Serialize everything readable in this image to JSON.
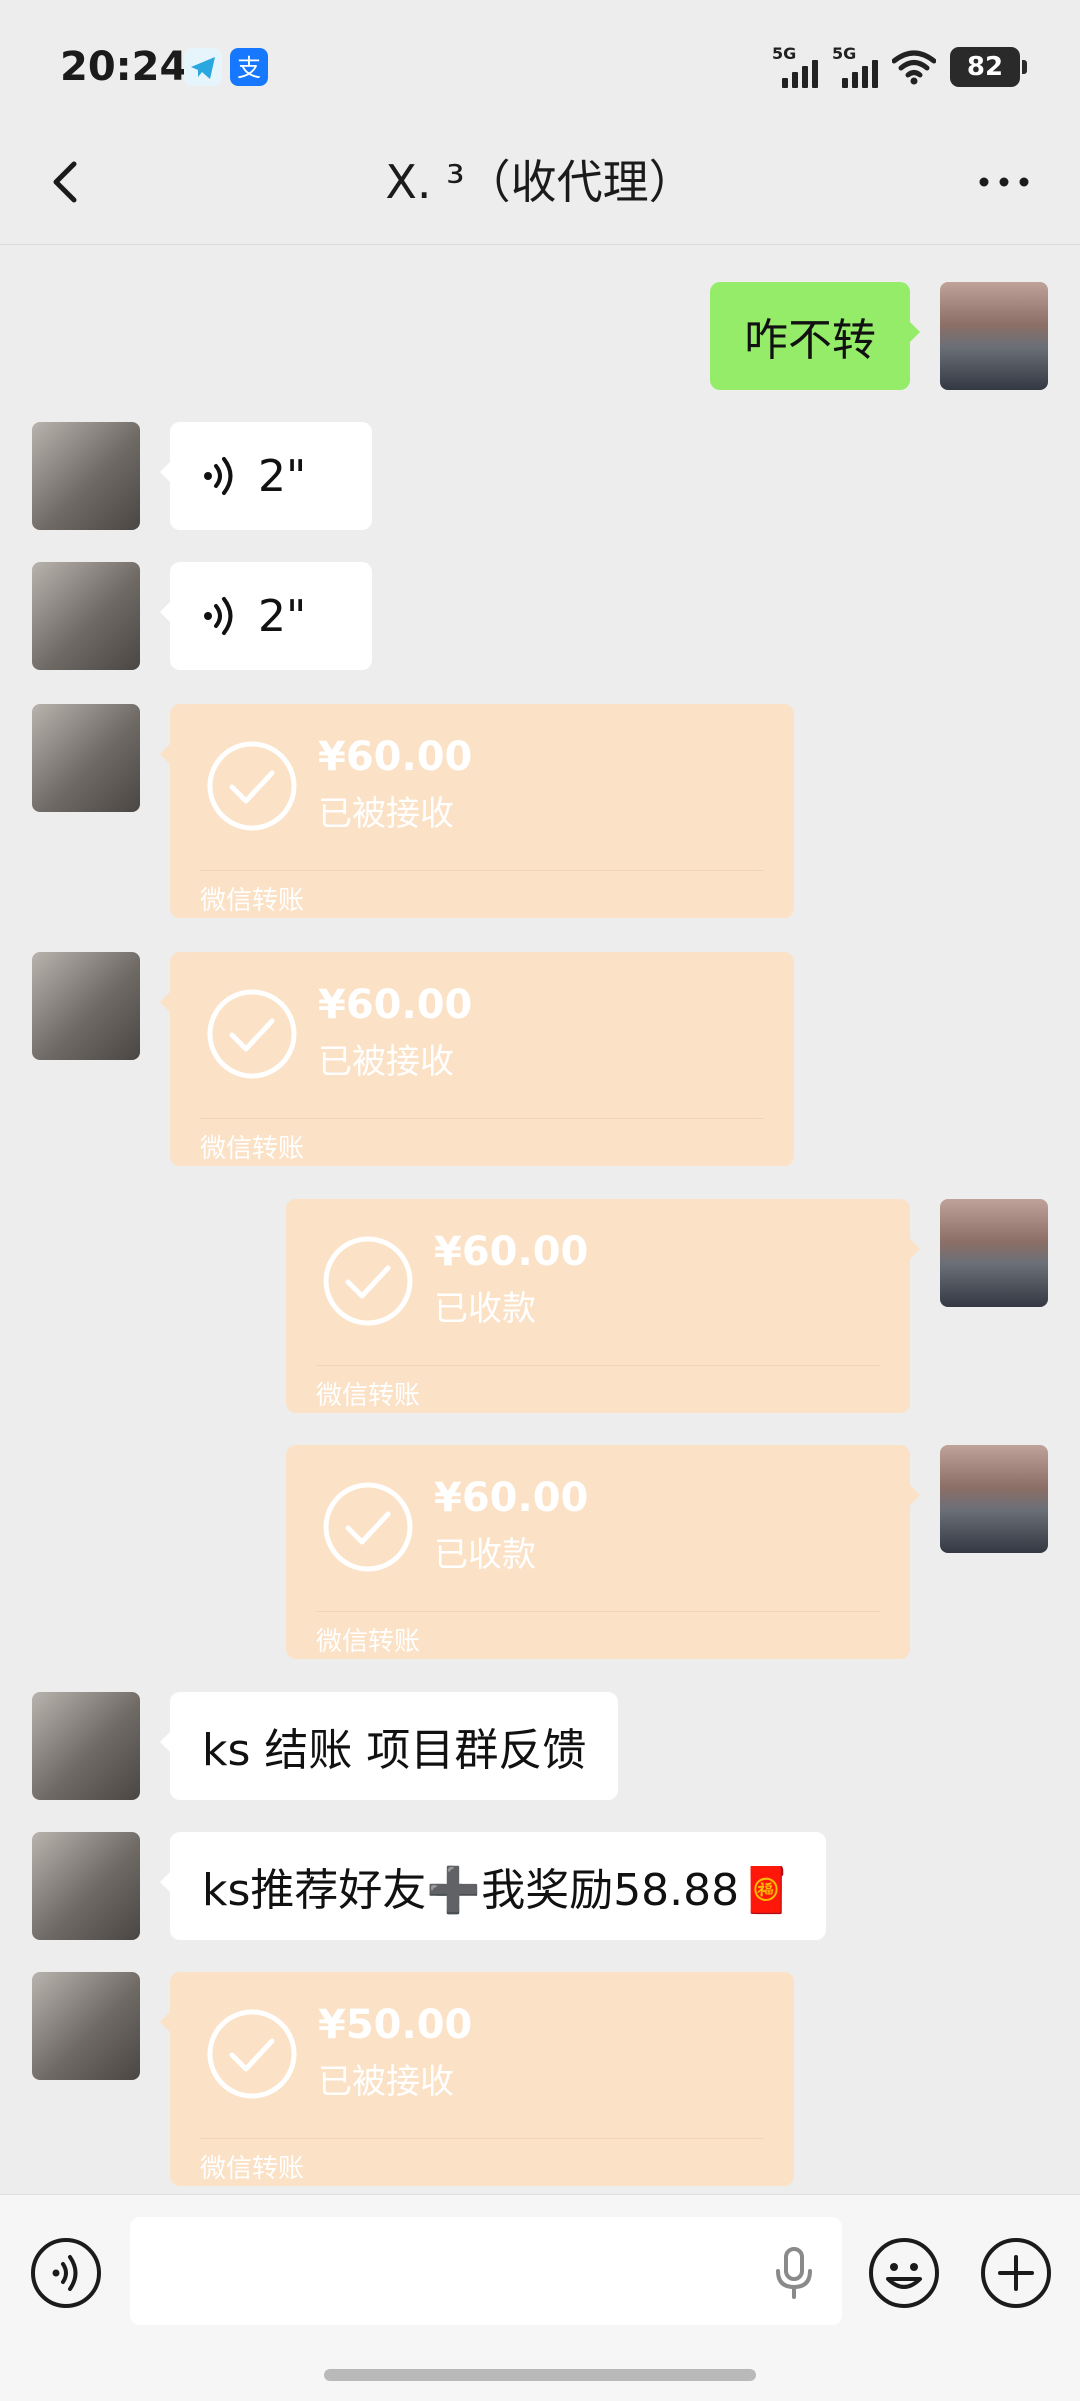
{
  "status_bar": {
    "time": "20:24",
    "network_tag_1": "5G",
    "network_tag_2": "5G",
    "battery": "82"
  },
  "header": {
    "title": "X. ³（收代理）"
  },
  "messages": {
    "m1": {
      "text": "咋不转"
    },
    "m2": {
      "duration": "2\""
    },
    "m3": {
      "duration": "2\""
    },
    "t1": {
      "amount": "¥60.00",
      "status": "已被接收",
      "footer": "微信转账"
    },
    "t2": {
      "amount": "¥60.00",
      "status": "已被接收",
      "footer": "微信转账"
    },
    "t3": {
      "amount": "¥60.00",
      "status": "已收款",
      "footer": "微信转账"
    },
    "t4": {
      "amount": "¥60.00",
      "status": "已收款",
      "footer": "微信转账"
    },
    "m8": {
      "text": "ks 结账 项目群反馈"
    },
    "m9": {
      "text": "ks推荐好友➕我奖励58.88🧧"
    },
    "t5": {
      "amount": "¥50.00",
      "status": "已被接收",
      "footer": "微信转账"
    }
  },
  "input": {
    "placeholder": ""
  },
  "colors": {
    "background": "#ededed",
    "self_bubble": "#95ec69",
    "transfer_bubble": "#fbe1c5"
  }
}
